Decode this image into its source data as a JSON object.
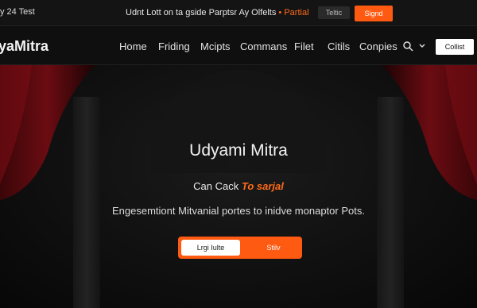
{
  "topbar": {
    "left_text": "y 24 Test",
    "message": "Udnt Lott on ta gside Parptsr Ay Olfelts",
    "message_accent": "Partial",
    "chip_label": "Teltic",
    "cta_label": "Signd"
  },
  "nav": {
    "brand": "yaMitra",
    "links": [
      "Home",
      "Friding",
      "Mcipts",
      "Commans",
      "Filet",
      "Citils",
      "Conpies"
    ],
    "search_icon": "search-icon",
    "chevron_icon": "chevron-down-icon",
    "button_label": "Collist"
  },
  "hero": {
    "title": "Udyami Mitra",
    "subtitle": "Can Cack",
    "subtitle_accent": "To sarjal",
    "description": "Engesemtiont Mitvanial portes to inidve monaptor Pots.",
    "primary_button": "Lrgi Iulte",
    "secondary_button": "Stilv"
  },
  "colors": {
    "accent": "#ff5a12",
    "background": "#0b0b0b",
    "curtain": "#5a0b0f"
  }
}
